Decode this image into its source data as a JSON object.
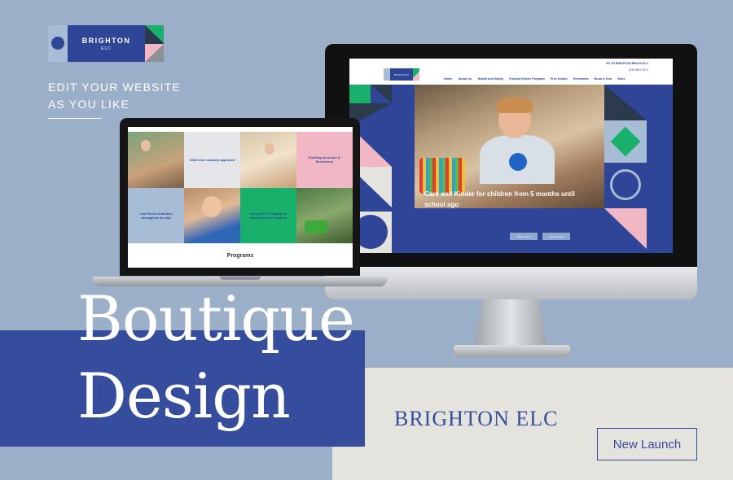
{
  "logo": {
    "line1": "BRIGHTON",
    "line2": "ELC"
  },
  "tagline": {
    "line1": "EDIT YOUR WEBSITE",
    "line2": "AS YOU LIKE"
  },
  "monitor_site": {
    "top_link": "GO TO BRIGHTON BEACH ELC",
    "top_phone": "(03) 9592 1571",
    "nav": [
      "Home",
      "About Us",
      "Health and Safety",
      "Funded Kinder Program",
      "Free Kinder",
      "Enrolment",
      "Book a Tour",
      "More"
    ],
    "hero_caption": "Care and Kinder for children from 5 months until school ago",
    "buttons": [
      "Book a Tour",
      "Explore More"
    ]
  },
  "laptop_site": {
    "cells": [
      "",
      "Child Care subsidy Approved",
      "",
      "Exciting Incursion & Excursions",
      "Low Parent Activities throughout the day",
      "",
      "Unique ELC Program & Funded Kinder Program",
      ""
    ],
    "section_title": "Programs"
  },
  "headline": {
    "line1": "Boutique",
    "line2": "Design"
  },
  "brand_name": "BRIGHTON ELC",
  "cta": "New Launch",
  "colors": {
    "primary": "#354d9c",
    "background": "#9bb0c8",
    "accent_green": "#18b06a",
    "accent_pink": "#f1b7c4",
    "cream": "#e5e3de"
  }
}
